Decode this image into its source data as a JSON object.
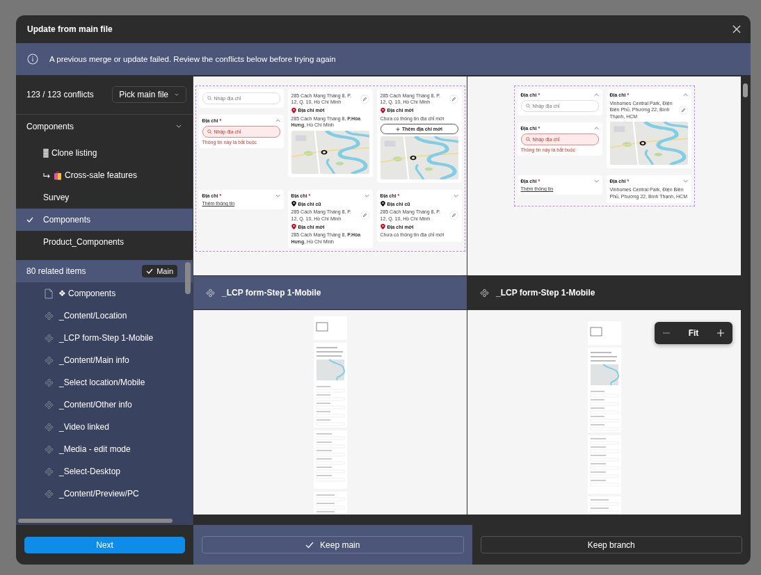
{
  "window": {
    "title": "Update from main file"
  },
  "banner": {
    "message": "A previous merge or update failed. Review the conflicts below before trying again"
  },
  "conflicts": {
    "count": "123 / 123 conflicts",
    "picker": "Pick main file"
  },
  "page_group": {
    "label": "Components",
    "expanded": true,
    "pages": [
      {
        "label": "Clone listing",
        "kind": "striped",
        "selected": false
      },
      {
        "label": "Cross-sale features",
        "kind": "shortcut",
        "selected": false
      },
      {
        "label": "Survey",
        "kind": "plain",
        "selected": false
      },
      {
        "label": "Components",
        "kind": "plain",
        "selected": true
      },
      {
        "label": "Product_Components",
        "kind": "plain",
        "selected": false
      }
    ]
  },
  "related": {
    "label": "80 related items",
    "badge": "Main",
    "items": [
      {
        "label": "❖ Components",
        "kind": "page"
      },
      {
        "label": "_Content/Location",
        "kind": "component"
      },
      {
        "label": "_LCP form-Step 1-Mobile",
        "kind": "component"
      },
      {
        "label": "_Content/Main info",
        "kind": "component"
      },
      {
        "label": "_Select location/Mobile",
        "kind": "component"
      },
      {
        "label": "_Content/Other info",
        "kind": "component"
      },
      {
        "label": "_Video linked",
        "kind": "component"
      },
      {
        "label": "_Media - edit mode",
        "kind": "component"
      },
      {
        "label": "_Select-Desktop",
        "kind": "component"
      },
      {
        "label": "_Content/Preview/PC",
        "kind": "component"
      }
    ]
  },
  "previews": [
    {
      "rows": [
        [
          [
            {
              "blocks": [
                {
                  "kind": "search",
                  "placeholder": "Nhập địa chỉ",
                  "error": false
                }
              ]
            },
            {
              "title": "Địa chỉ",
              "required_mark": "*",
              "expanded": true,
              "blocks": [
                {
                  "kind": "search",
                  "placeholder": "Nhập địa chỉ",
                  "error": true
                },
                {
                  "kind": "error",
                  "text": "Thông tin này là bắt buộc"
                }
              ]
            }
          ],
          [
            {
              "blocks": [
                {
                  "kind": "address",
                  "text": "285 Cách Mạng Tháng 8, P. 12, Q. 10, Hồ Chí Minh",
                  "edit": true
                },
                {
                  "kind": "pin",
                  "text": "Địa chỉ mới",
                  "color": "#d0021b"
                },
                {
                  "kind": "address",
                  "text": "285 Cách Mạng Tháng 8, **P.Hòa Hưng**, Hồ Chí Minh",
                  "edit": false
                },
                {
                  "kind": "map"
                }
              ]
            }
          ],
          [
            {
              "blocks": [
                {
                  "kind": "address",
                  "text": "285 Cách Mạng Tháng 8, P. 12, Q. 10, Hồ Chí Minh",
                  "edit": true
                },
                {
                  "kind": "pin",
                  "text": "Địa chỉ mới",
                  "color": "#d0021b"
                },
                {
                  "kind": "note",
                  "text": "Chưa có thông tin địa chỉ mới"
                },
                {
                  "kind": "add",
                  "text": "Thêm địa chỉ mới"
                },
                {
                  "kind": "map"
                }
              ]
            }
          ]
        ],
        [
          [
            {
              "title": "Địa chỉ",
              "required_mark": "*",
              "expanded": false,
              "blocks": [
                {
                  "kind": "link",
                  "text": "Thêm thông tin"
                }
              ]
            }
          ],
          [
            {
              "title": "Địa chỉ",
              "required_mark": "*",
              "expanded": false,
              "blocks": [
                {
                  "kind": "pin",
                  "text": "Địa chỉ cũ",
                  "color": "#111111"
                },
                {
                  "kind": "address",
                  "text": "285 Cách Mạng Tháng 8, P. 12, Q. 10, Hồ Chí Minh",
                  "edit": true
                },
                {
                  "kind": "pin",
                  "text": "Địa chỉ mới",
                  "color": "#d0021b"
                },
                {
                  "kind": "address",
                  "text": "285 Cách Mạng Tháng 8, **P.Hòa Hưng**, Hồ Chí Minh",
                  "edit": false
                }
              ]
            }
          ],
          [
            {
              "title": "Địa chỉ",
              "required_mark": "*",
              "expanded": false,
              "blocks": [
                {
                  "kind": "pin",
                  "text": "Địa chỉ cũ",
                  "color": "#111111"
                },
                {
                  "kind": "address",
                  "text": "285 Cách Mạng Tháng 8, P. 12, Q. 10, Hồ Chí Minh",
                  "edit": true
                },
                {
                  "kind": "pin",
                  "text": "Địa chỉ mới",
                  "color": "#d0021b"
                },
                {
                  "kind": "note",
                  "text": "Chưa có thông tin địa chỉ mới"
                }
              ]
            }
          ]
        ]
      ]
    },
    {
      "rows": [
        [
          [
            {
              "title": "Địa chỉ",
              "required_mark": "*",
              "expanded": true,
              "blocks": [
                {
                  "kind": "search",
                  "placeholder": "Nhập địa chỉ",
                  "error": false
                }
              ]
            },
            {
              "title": "Địa chỉ",
              "required_mark": "*",
              "expanded": true,
              "blocks": [
                {
                  "kind": "search",
                  "placeholder": "Nhập địa chỉ",
                  "error": true
                },
                {
                  "kind": "error",
                  "text": "Thông tin này là bắt buộc"
                }
              ]
            }
          ],
          [
            {
              "title": "Địa chỉ",
              "required_mark": "*",
              "expanded": true,
              "blocks": [
                {
                  "kind": "address",
                  "text": "Vinhomes Central Park, Điện Biên Phủ, Phường 22, Bình Thạnh, HCM",
                  "edit": true
                },
                {
                  "kind": "map"
                }
              ]
            }
          ]
        ],
        [
          [
            {
              "title": "Địa chỉ",
              "required_mark": "*",
              "expanded": false,
              "blocks": [
                {
                  "kind": "link",
                  "text": "Thêm thông tin"
                }
              ]
            }
          ],
          [
            {
              "title": "Địa chỉ",
              "required_mark": "*",
              "expanded": false,
              "blocks": [
                {
                  "kind": "address",
                  "text": "Vinhomes Central Park, Điện Biên Phủ, Phường 22, Bình Thạnh, HCM",
                  "edit": false
                }
              ]
            }
          ]
        ]
      ]
    }
  ],
  "frame_headers": [
    {
      "label": "_LCP form-Step 1-Mobile",
      "selected": true
    },
    {
      "label": "_LCP form-Step 1-Mobile",
      "selected": false
    }
  ],
  "zoom": {
    "label": "Fit"
  },
  "footer": {
    "next": "Next",
    "choices": [
      {
        "label": "Keep main",
        "selected": true
      },
      {
        "label": "Keep branch",
        "selected": false
      }
    ]
  }
}
